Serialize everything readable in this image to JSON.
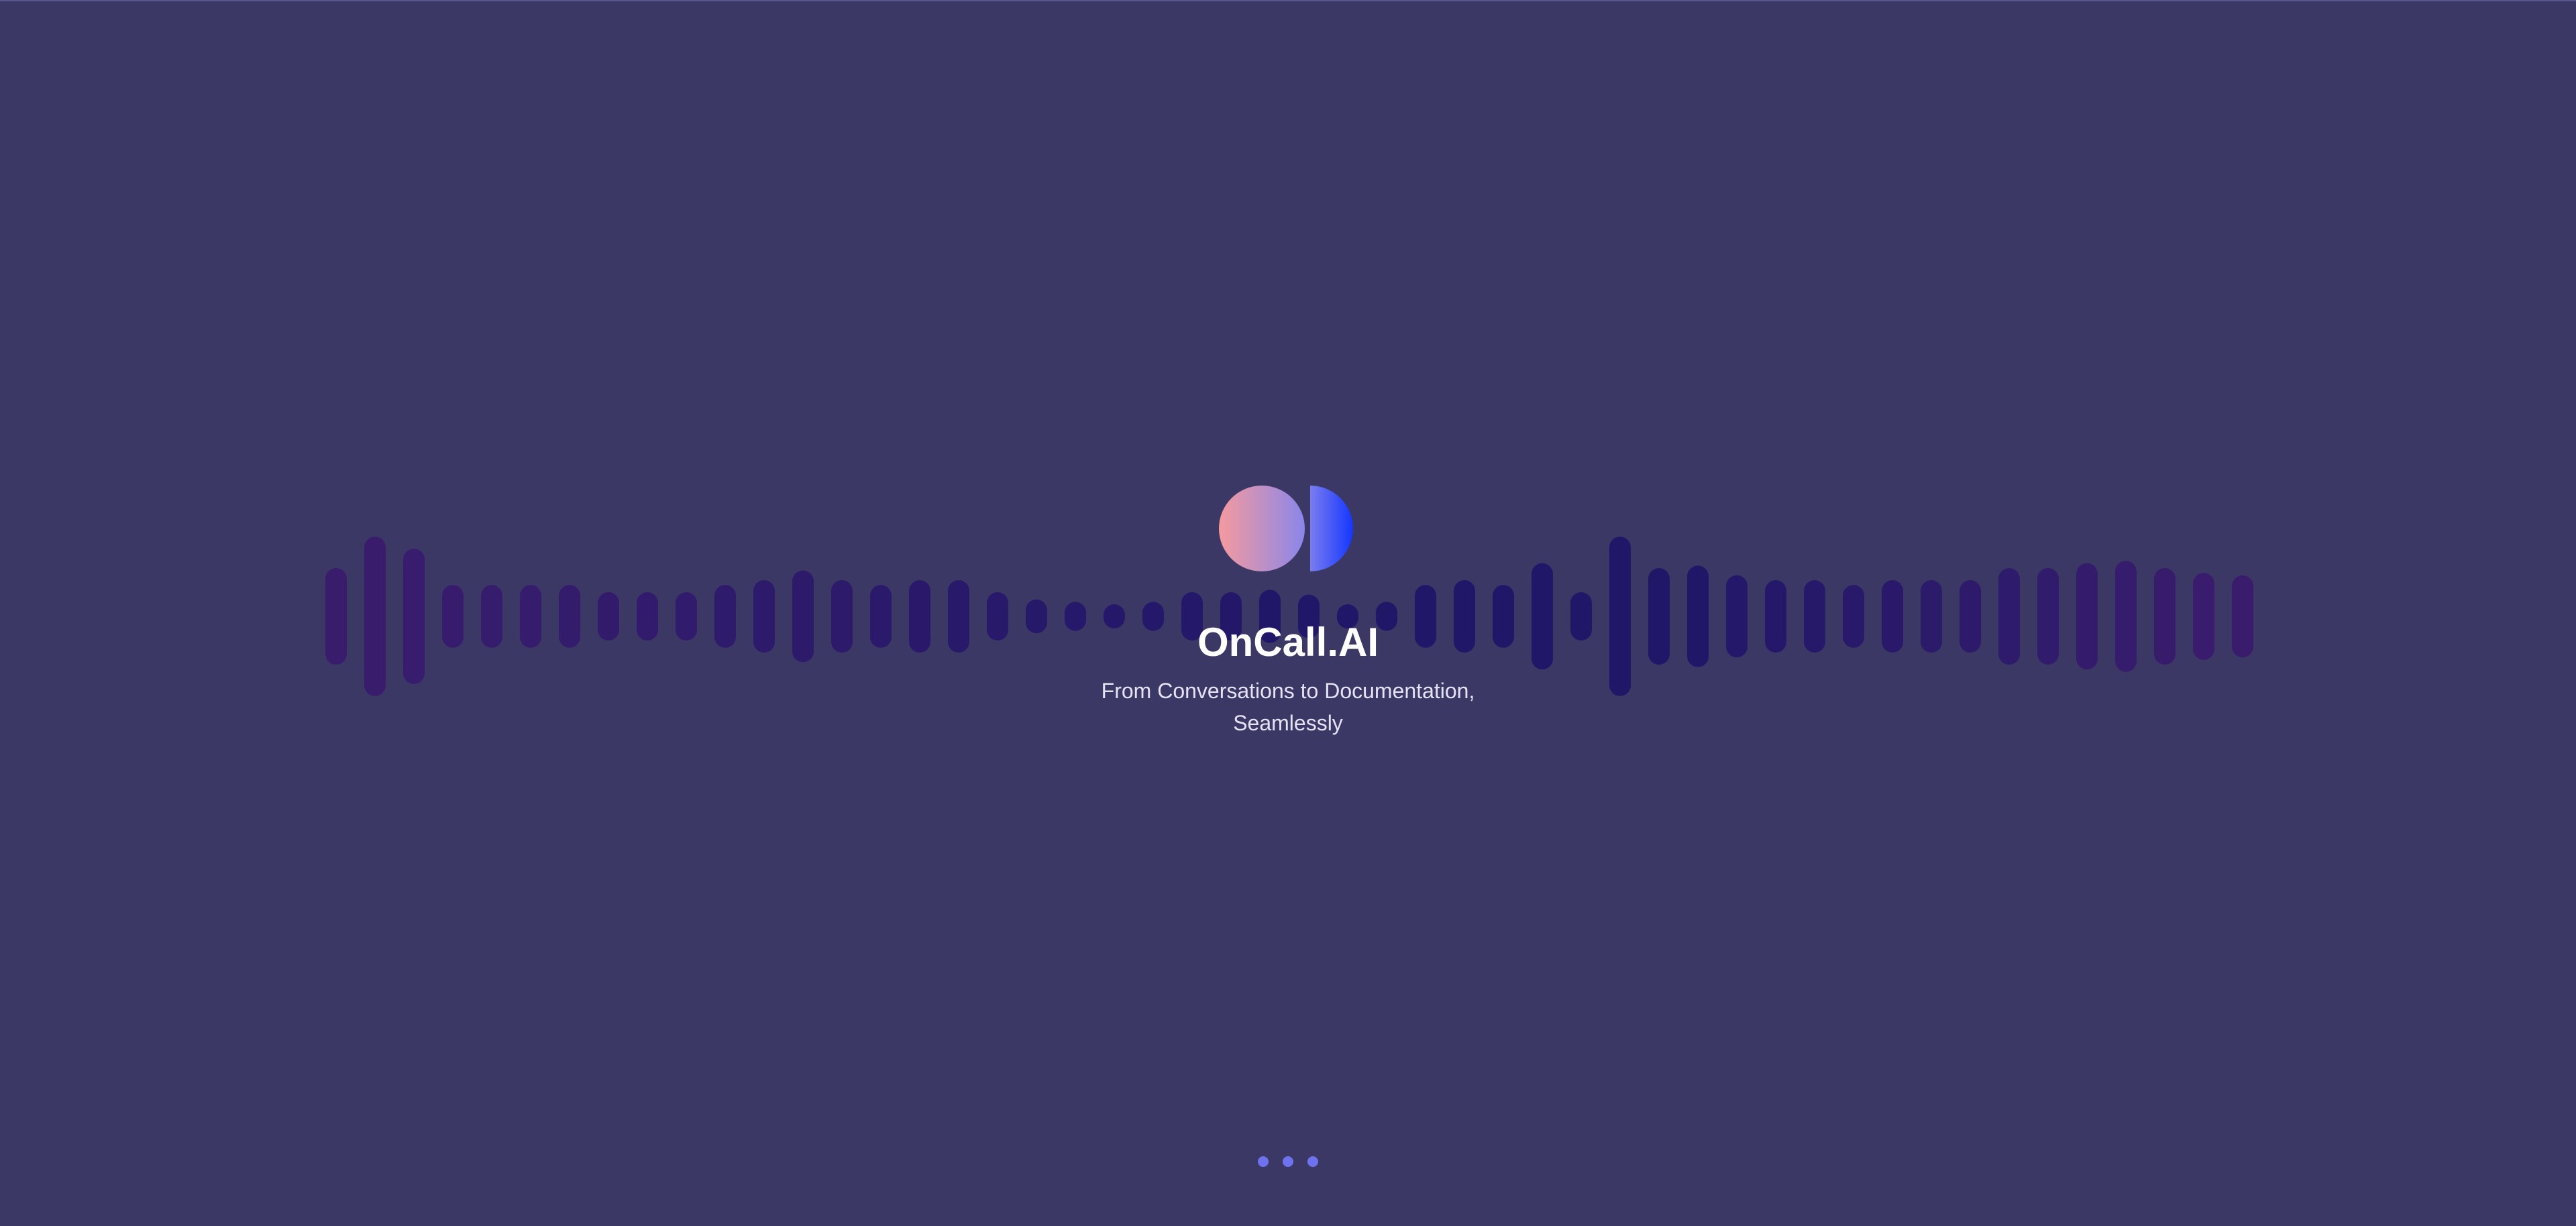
{
  "app": {
    "brand_name": "OnCall.AI",
    "tagline_line1": "From Conversations to Documentation,",
    "tagline_line2": "Seamlessly"
  },
  "colors": {
    "background": "#3c3866",
    "logo_left_gradient": [
      "#f59a9e",
      "#8a86ea"
    ],
    "logo_right_gradient": [
      "#7a7cf0",
      "#1436ff"
    ],
    "wave_purple": "#3a186e",
    "wave_indigo": "#1b126a",
    "loading_dot": "#6e72ee"
  },
  "icons": {
    "logo": "oncall-ai-logo-icon",
    "waveform": "audio-waveform",
    "loading": "loading-dots-icon"
  },
  "waveform": {
    "bar_levels": [
      0.4,
      0.66,
      0.56,
      0.26,
      0.26,
      0.26,
      0.26,
      0.2,
      0.2,
      0.2,
      0.26,
      0.3,
      0.38,
      0.3,
      0.26,
      0.3,
      0.3,
      0.2,
      0.14,
      0.12,
      0.1,
      0.12,
      0.2,
      0.2,
      0.22,
      0.18,
      0.1,
      0.12,
      0.26,
      0.3,
      0.26,
      0.44,
      0.2,
      0.66,
      0.4,
      0.42,
      0.34,
      0.3,
      0.3,
      0.26,
      0.3,
      0.3,
      0.3,
      0.4,
      0.4,
      0.44,
      0.46,
      0.4,
      0.36,
      0.34
    ]
  },
  "loading": {
    "dot_count": 3
  }
}
